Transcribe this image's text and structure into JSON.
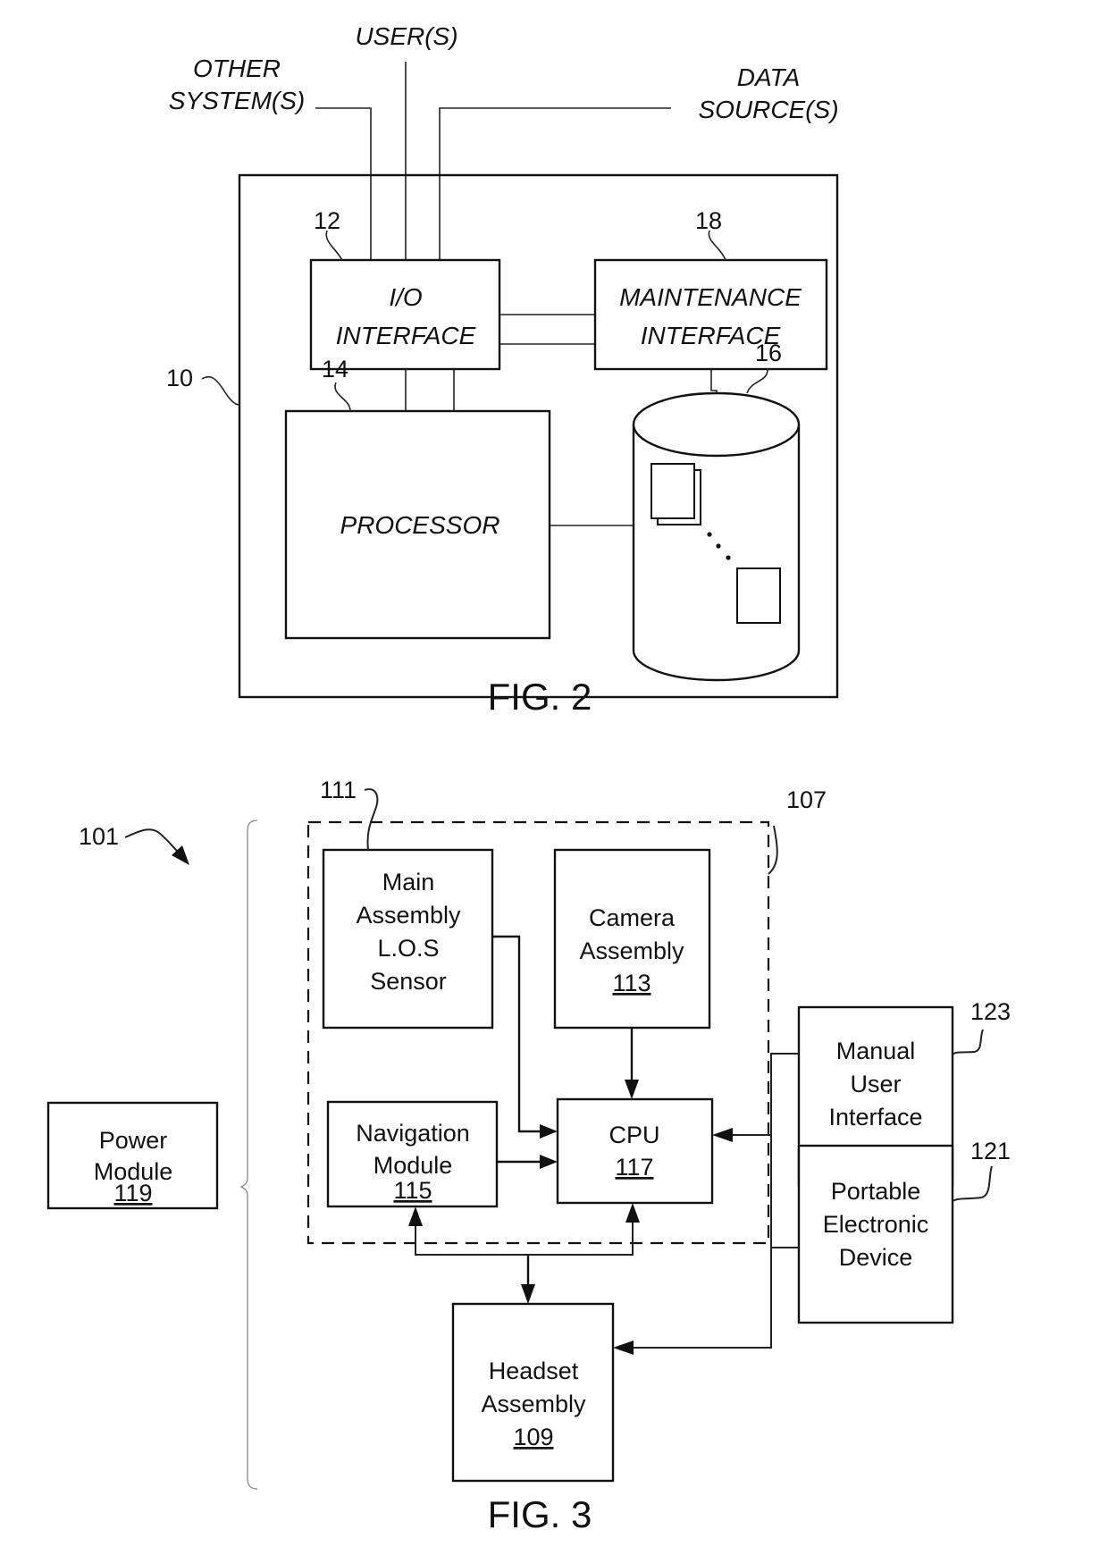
{
  "fig2": {
    "caption": "FIG. 2",
    "external": {
      "other_systems": [
        "OTHER",
        "SYSTEM(S)"
      ],
      "users": "USER(S)",
      "data_sources": [
        "DATA",
        "SOURCE(S)"
      ]
    },
    "refs": {
      "system": "10",
      "io": "12",
      "processor": "14",
      "storage": "16",
      "maintenance": "18"
    },
    "io_interface": [
      "I/O",
      "INTERFACE"
    ],
    "maintenance_interface": [
      "MAINTENANCE",
      "INTERFACE"
    ],
    "processor": "PROCESSOR"
  },
  "fig3": {
    "caption": "FIG. 3",
    "refs": {
      "system": "101",
      "group": "107",
      "main_assembly": "111",
      "manual_ui": "123",
      "portable": "121"
    },
    "main_assembly": [
      "Main",
      "Assembly",
      "L.O.S",
      "Sensor"
    ],
    "camera": {
      "lines": [
        "Camera",
        "Assembly"
      ],
      "num": "113"
    },
    "cpu": {
      "lines": [
        "CPU"
      ],
      "num": "117"
    },
    "navigation": {
      "lines": [
        "Navigation",
        "Module"
      ],
      "num": "115"
    },
    "power": {
      "lines": [
        "Power",
        "Module"
      ],
      "num": "119"
    },
    "headset": {
      "lines": [
        "Headset",
        "Assembly"
      ],
      "num": "109"
    },
    "manual_ui": [
      "Manual",
      "User",
      "Interface"
    ],
    "portable": [
      "Portable",
      "Electronic",
      "Device"
    ]
  }
}
